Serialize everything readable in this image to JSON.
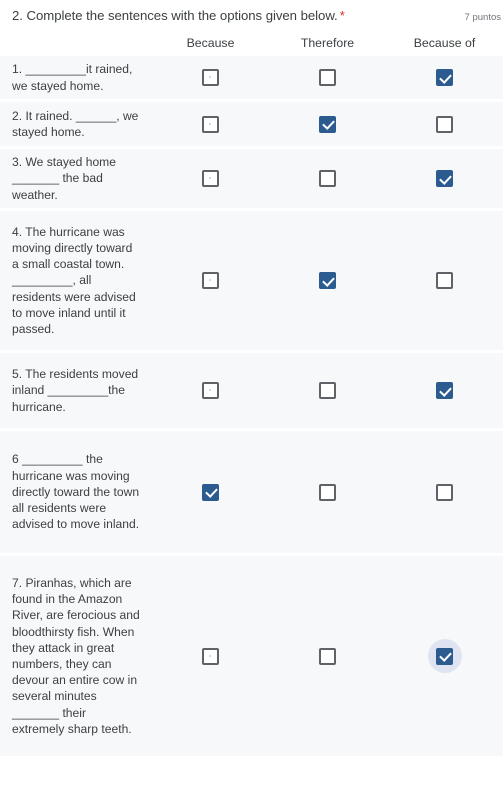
{
  "question": {
    "number_and_text": "2. Complete the sentences with the options given below.",
    "required_marker": "*",
    "points": "7 puntos"
  },
  "grid": {
    "columns": [
      "Because",
      "Therefore",
      "Because of"
    ],
    "rows": [
      {
        "label": "1. _________it rained, we stayed home.",
        "selected": "Because of",
        "states": [
          "unchecked-speck",
          "unchecked",
          "checked"
        ],
        "focused_column": null
      },
      {
        "label": "2. It rained. ______, we stayed home.",
        "selected": "Therefore",
        "states": [
          "unchecked-speck",
          "checked",
          "unchecked"
        ],
        "focused_column": null
      },
      {
        "label": "3. We stayed home _______ the bad weather.",
        "selected": "Because of",
        "states": [
          "unchecked-speck",
          "unchecked",
          "checked"
        ],
        "focused_column": null
      },
      {
        "label": "4. The hurricane was moving directly toward a small coastal town. _________, all residents were advised to move inland until it passed.",
        "selected": "Therefore",
        "states": [
          "unchecked-speck",
          "checked",
          "unchecked"
        ],
        "focused_column": null
      },
      {
        "label": "5. The residents moved inland _________the hurricane.",
        "selected": "Because of",
        "states": [
          "unchecked-speck",
          "unchecked",
          "checked"
        ],
        "focused_column": null
      },
      {
        "label": "6 _________ the hurricane was moving directly toward the town all residents were advised to move inland.",
        "selected": "Because",
        "states": [
          "checked",
          "unchecked",
          "unchecked"
        ],
        "focused_column": null
      },
      {
        "label": "7. Piranhas, which are found in the Amazon River, are ferocious and bloodthirsty fish. When they attack in great numbers, they can devour an entire cow in several minutes _______ their extremely sharp teeth.",
        "selected": "Because of",
        "states": [
          "unchecked-speck",
          "unchecked",
          "checked"
        ],
        "focused_column": "Because of"
      }
    ]
  },
  "colors": {
    "checkbox_checked": "#2c5b8f",
    "checkbox_border": "#5f6368",
    "row_background": "#f7f8f9",
    "required_asterisk": "#d93025",
    "focus_ring": "#dfe4f2",
    "text": "#3c4043",
    "points_text": "#70757a"
  }
}
